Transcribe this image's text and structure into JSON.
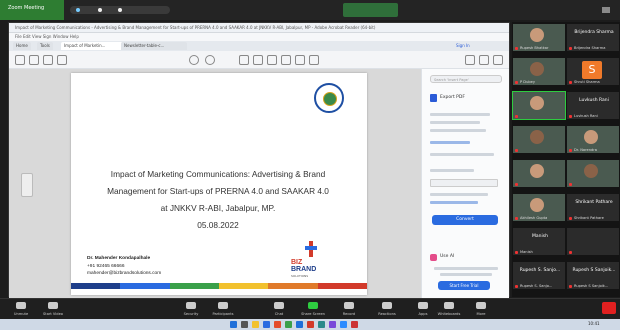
{
  "zoom": {
    "top_left_label": "Zoom Meeting",
    "top_status": "",
    "controls": [
      {
        "label": "Unmute"
      },
      {
        "label": "Start Video"
      },
      {
        "label": "Security"
      },
      {
        "label": "Participants"
      },
      {
        "label": "Chat"
      },
      {
        "label": "Share Screen"
      },
      {
        "label": "Record"
      },
      {
        "label": "Reactions"
      },
      {
        "label": "Apps"
      },
      {
        "label": "Whiteboards"
      },
      {
        "label": "More"
      }
    ],
    "end_label": "End"
  },
  "pdf": {
    "window_title": "Impact of Marketing Communications - Advertising & Brand Management for Start-ups of PRERNA 4.0 and SAAKAR 4.0 at JNKKV R-ABI, Jabalpur, MP - Adobe Acrobat Reader (64-bit)",
    "menu": "File   Edit   View   Sign   Window   Help",
    "tabs": [
      "Home",
      "Tools",
      "Impact of Marketin...",
      "Newsletter-table-c..."
    ],
    "sign_in": "Sign In",
    "slide_title_lines": [
      "Impact of Marketing Communications: Advertising & Brand",
      "Management for Start-ups of PRERNA 4.0 and SAAKAR 4.0",
      "at JNKKV R-ABI, Jabalpur, MP.",
      "05.08.2022"
    ],
    "speaker_name": "Dr. Mahender Kondapalhale",
    "speaker_phone": "+91 92465 66666",
    "speaker_email": "mahender@bizbrandsolutions.com",
    "brand_line1": "BIZ",
    "brand_line2": "BRAND",
    "brand_line3": "SOLUTIONS",
    "color_bar": [
      "#1e3e8a",
      "#2a6be0",
      "#3aa04a",
      "#f2c12e",
      "#e07a2a",
      "#d23a2a"
    ]
  },
  "side_panel": {
    "search_placeholder": "Search 'Insert Page'",
    "export_label": "Export PDF",
    "convert_button": "Convert",
    "ai_label": "Use AI",
    "trial_button": "Start Free Trial"
  },
  "participants": [
    {
      "name": "Rupesh Bhatkar",
      "video": true,
      "face": "light"
    },
    {
      "name": "Brijendra Sharma",
      "video": false
    },
    {
      "name": "P Dubey",
      "video": true,
      "face": "dark"
    },
    {
      "name": "Shruti Sharma",
      "video": false,
      "avatar": "S"
    },
    {
      "name": "",
      "video": true,
      "face": "light",
      "highlight": true
    },
    {
      "name": "Luvkush Rani",
      "video": false
    },
    {
      "name": "",
      "video": true,
      "face": "dark"
    },
    {
      "name": "Dr. Narendra",
      "video": true,
      "face": "light"
    },
    {
      "name": "",
      "video": true,
      "face": "light"
    },
    {
      "name": "",
      "video": true,
      "face": "dark"
    },
    {
      "name": "Akhilesh Gupta",
      "video": true,
      "face": "light"
    },
    {
      "name": "Shrikant Pathare",
      "video": false
    },
    {
      "name": "Manish",
      "video": false
    },
    {
      "name": "",
      "video": false
    },
    {
      "name": "Rupesh S. Sanjo...",
      "video": false
    },
    {
      "name": "Rupesh S Sanjoik...",
      "video": false
    }
  ],
  "taskbar_time": "10:41"
}
